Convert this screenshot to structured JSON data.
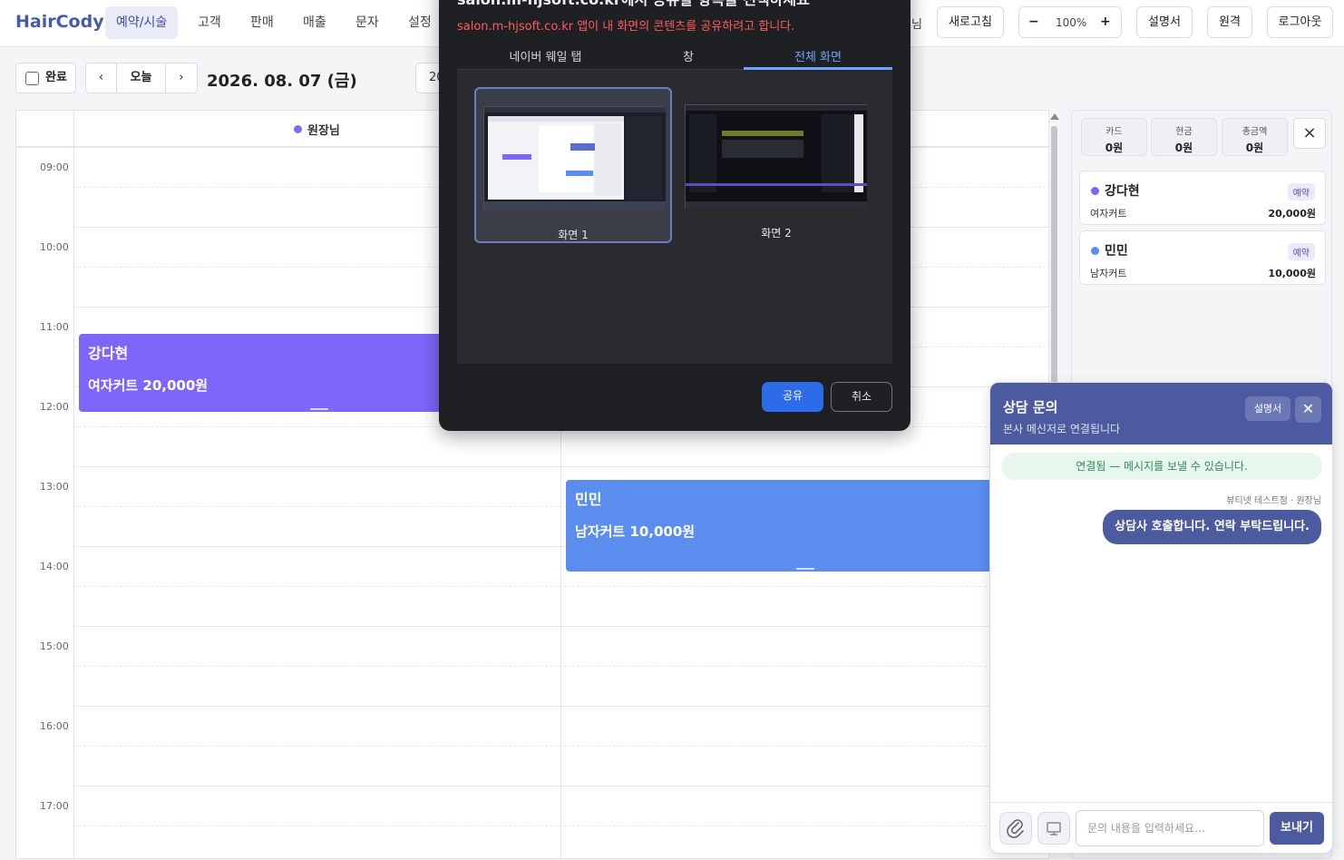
{
  "header": {
    "logo": "HairCody",
    "nav": [
      "예약/시술",
      "고객",
      "판매",
      "매출",
      "문자",
      "설정"
    ],
    "partial_label": "님",
    "refresh": "새로고침",
    "zoom": {
      "minus": "−",
      "value": "100%",
      "plus": "+"
    },
    "manual": "설명서",
    "remote": "원격",
    "logout": "로그아웃"
  },
  "toolbar": {
    "complete_label": "완료",
    "prev": "‹",
    "today": "오늘",
    "next": "›",
    "date": "2026. 08. 07 (금)",
    "partial_select": "20"
  },
  "calendar": {
    "staff": "원장님",
    "times": [
      "09:00",
      "10:00",
      "11:00",
      "12:00",
      "13:00",
      "14:00",
      "15:00",
      "16:00",
      "17:00"
    ],
    "appointments": [
      {
        "name": "강다현",
        "service": "여자커트 20,000원",
        "color": "#7f66fb"
      },
      {
        "name": "민민",
        "service": "남자커트 10,000원",
        "color": "#5b8dee"
      }
    ]
  },
  "summary": {
    "boxes": [
      {
        "label": "카드",
        "value": "0원"
      },
      {
        "label": "현금",
        "value": "0원"
      },
      {
        "label": "총금액",
        "value": "0원"
      }
    ],
    "close": "×",
    "cards": [
      {
        "name": "강다현",
        "badge": "예약",
        "service": "여자커트",
        "price": "20,000원",
        "color": "#7f66fb"
      },
      {
        "name": "민민",
        "badge": "예약",
        "service": "남자커트",
        "price": "10,000원",
        "color": "#5b8dee"
      }
    ]
  },
  "share_dialog": {
    "title": "salon.m-hjsoft.co.kr에서 공유할 항목을 선택하세요",
    "subtitle": "salon.m-hjsoft.co.kr 앱이 내 화면의 콘텐츠를 공유하려고 합니다.",
    "tabs": [
      "네이버 웨일 탭",
      "창",
      "전체 화면"
    ],
    "screens": [
      "화면 1",
      "화면 2"
    ],
    "share_button": "공유",
    "cancel_button": "취소"
  },
  "chat": {
    "title": "상담 문의",
    "subtitle": "본사 메신저로 연결됩니다",
    "manual": "설명서",
    "close": "✕",
    "status": "연결됨 — 메시지를 보낼 수 있습니다.",
    "sender": "뷰티넷 테스트점 · 원장님",
    "message": "상담사 호출합니다. 연락 부탁드립니다.",
    "placeholder": "문의 내용을 입력하세요…",
    "send": "보내기"
  },
  "colors": {
    "accent": "#4c5a9f",
    "dialog_accent": "#6fa4ff",
    "share_button": "#2d6be8"
  }
}
